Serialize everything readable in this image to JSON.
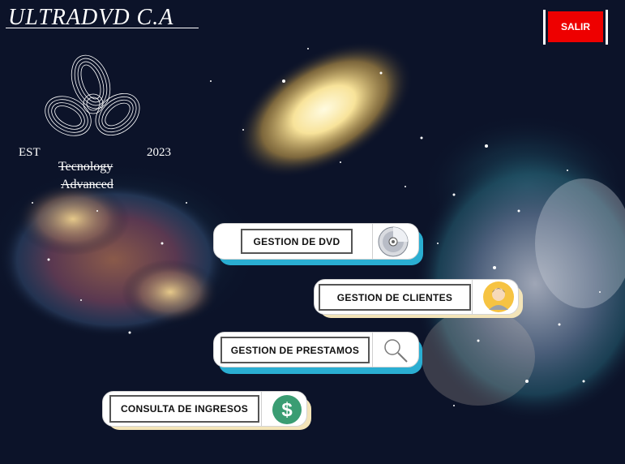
{
  "app": {
    "title": "ULTRADVD C.A"
  },
  "header": {
    "exit_label": "SALIR"
  },
  "brand": {
    "est_left": "EST",
    "est_right": "2023",
    "tagline_line1": "Tecnology",
    "tagline_line2": "Advanced"
  },
  "menu": [
    {
      "label": "GESTION DE DVD",
      "icon": "dvd-disc-icon",
      "accent": "#2aaed2"
    },
    {
      "label": "GESTION DE CLIENTES",
      "icon": "user-avatar-icon",
      "accent": "#f3e4b8"
    },
    {
      "label": "GESTION DE PRESTAMOS",
      "icon": "magnifier-icon",
      "accent": "#2aaed2"
    },
    {
      "label": "CONSULTA DE INGRESOS",
      "icon": "dollar-icon",
      "accent": "#f3e4b8"
    }
  ],
  "colors": {
    "background": "#0c1329",
    "exit_button": "#ee0000",
    "dollar_badge": "#3a9d73"
  }
}
